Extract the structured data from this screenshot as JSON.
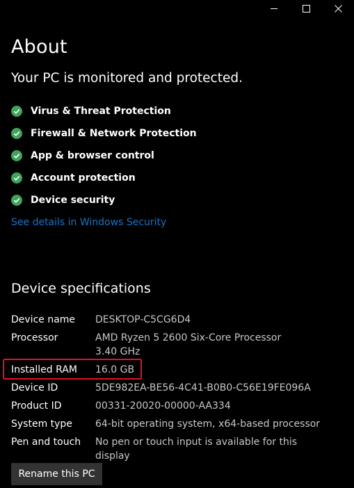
{
  "window": {
    "controls": [
      {
        "name": "minimize-icon"
      },
      {
        "name": "maximize-icon"
      },
      {
        "name": "close-icon"
      }
    ]
  },
  "page": {
    "title": "About",
    "protection_status": "Your PC is monitored and protected."
  },
  "security": {
    "items": [
      {
        "label": "Virus & Threat Protection",
        "icon": "check-circle-icon"
      },
      {
        "label": "Firewall & Network Protection",
        "icon": "check-circle-icon"
      },
      {
        "label": "App & browser control",
        "icon": "check-circle-icon"
      },
      {
        "label": "Account protection",
        "icon": "check-circle-icon"
      },
      {
        "label": "Device security",
        "icon": "check-circle-icon"
      }
    ],
    "details_link": "See details in Windows Security"
  },
  "specs": {
    "title": "Device specifications",
    "rows": [
      {
        "label": "Device name",
        "value": "DESKTOP-C5CG6D4"
      },
      {
        "label": "Processor",
        "value": "AMD Ryzen 5 2600 Six-Core Processor",
        "value2": "3.40 GHz"
      },
      {
        "label": "Installed RAM",
        "value": "16.0 GB"
      },
      {
        "label": "Device ID",
        "value": "5DE982EA-BE56-4C41-B0B0-C56E19FE096A"
      },
      {
        "label": "Product ID",
        "value": "00331-20020-00000-AA334"
      },
      {
        "label": "System type",
        "value": "64-bit operating system, x64-based processor"
      },
      {
        "label": "Pen and touch",
        "value": "No pen or touch input is available for this display"
      }
    ]
  },
  "actions": {
    "rename_label": "Rename this PC"
  },
  "colors": {
    "background": "#000000",
    "check_green": "#3fa35b",
    "link_blue": "#1a73c6",
    "highlight_red": "#e81123",
    "button_bg": "#333333"
  }
}
